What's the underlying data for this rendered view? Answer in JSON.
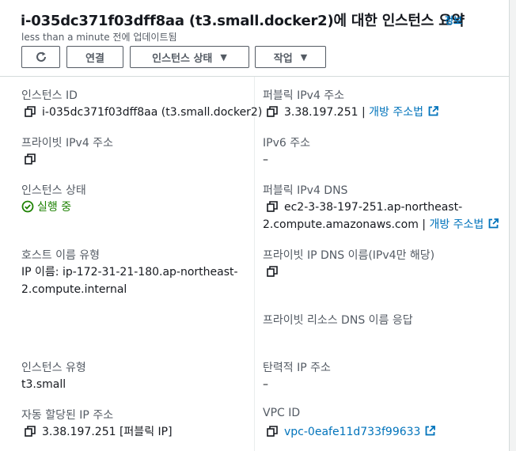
{
  "header": {
    "title": "i-035dc371f03dff8aa (t3.small.docker2)에 대한 인스턴스 요약",
    "info_link": "정보",
    "subtitle": "less than a minute 전에 업데이트됨",
    "connect_label": "연결",
    "instance_state_label": "인스턴스 상태",
    "actions_label": "작업"
  },
  "details": {
    "instance_id_label": "인스턴스 ID",
    "instance_id_value": "i-035dc371f03dff8aa (t3.small.docker2)",
    "public_ipv4_label": "퍼블릭 IPv4 주소",
    "public_ipv4_value": "3.38.197.251",
    "public_ipv4_sep": " | ",
    "open_address_label": "개방 주소법",
    "private_ipv4_label": "프라이빗 IPv4 주소",
    "ipv6_label": "IPv6 주소",
    "ipv6_value": "–",
    "instance_state_label": "인스턴스 상태",
    "instance_state_value": "실행 중",
    "public_dns_label": "퍼블릭 IPv4 DNS",
    "public_dns_line1": "ec2-3-38-197-251.ap-northeast-",
    "public_dns_line2": "2.compute.amazonaws.com",
    "public_dns_sep": " | ",
    "public_dns_open_label": "개방 주소법",
    "hostname_type_label": "호스트 이름 유형",
    "hostname_value_line1": "IP 이름: ip-172-31-21-180.ap-northeast-",
    "hostname_value_line2": "2.compute.internal",
    "private_dns_label": "프라이빗 IP DNS 이름(IPv4만 해당)",
    "private_resource_dns_label": "프라이빗 리소스 DNS 이름 응답",
    "instance_type_label": "인스턴스 유형",
    "instance_type_value": "t3.small",
    "elastic_ip_label": "탄력적 IP 주소",
    "elastic_ip_value": "–",
    "auto_ip_label": "자동 할당된 IP 주소",
    "auto_ip_value": "3.38.197.251 [퍼블릭 IP]",
    "vpc_id_label": "VPC ID",
    "vpc_id_value": "vpc-0eafe11d733f99633"
  },
  "colors": {
    "link": "#0073bb",
    "running": "#1d8102",
    "label": "#545b64",
    "text": "#16191f"
  }
}
